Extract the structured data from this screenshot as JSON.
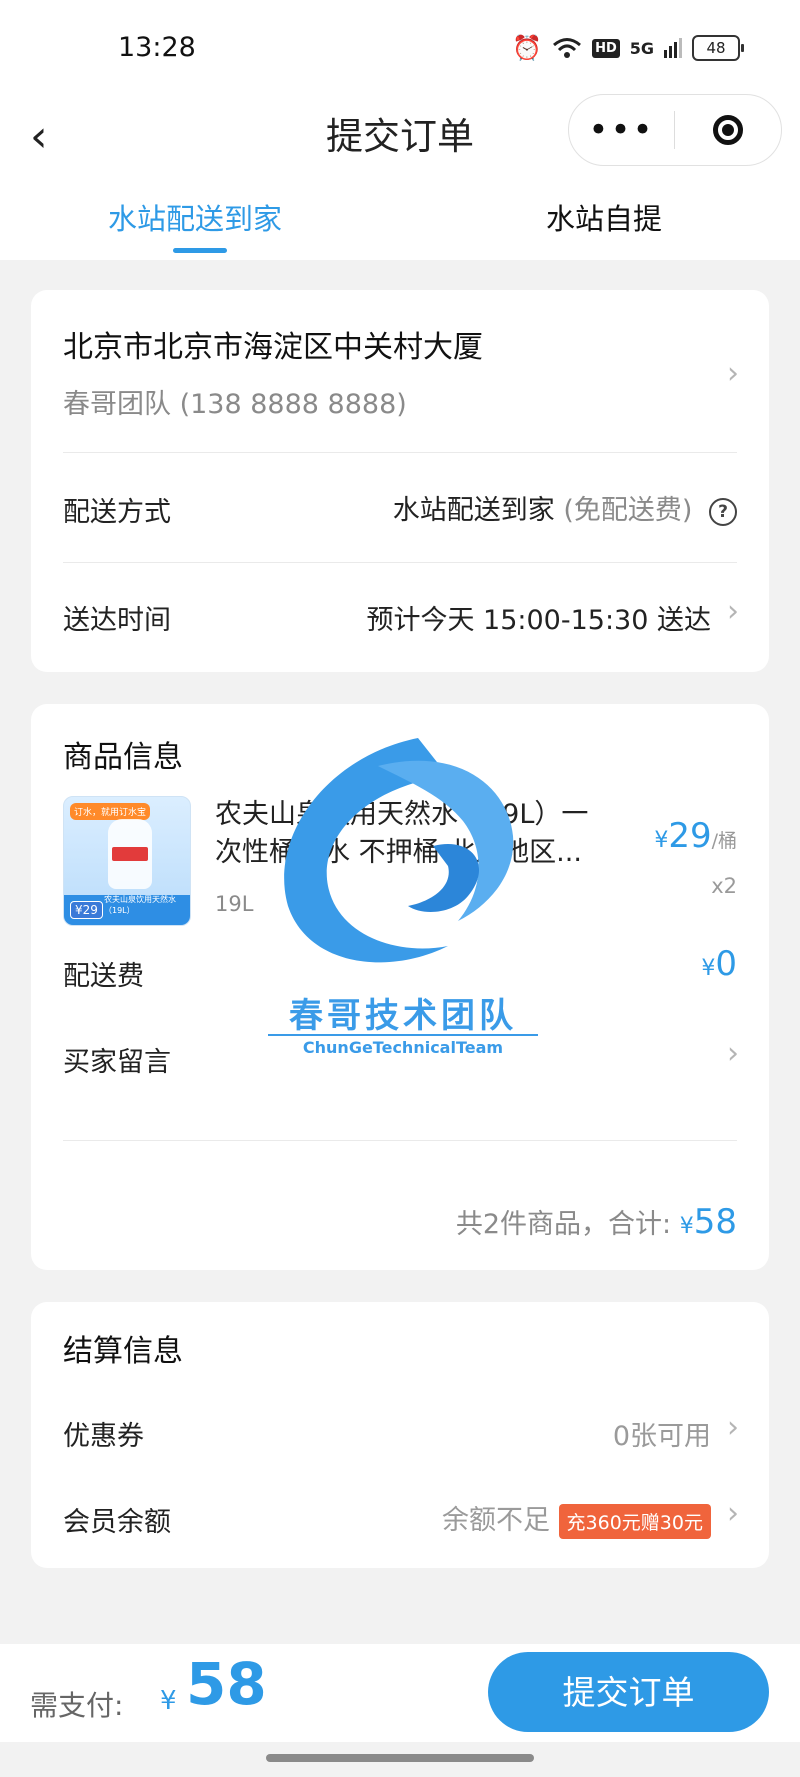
{
  "status_bar": {
    "time": "13:28",
    "battery": "48",
    "hd": "HD",
    "signal": "5G"
  },
  "header": {
    "title": "提交订单",
    "back_icon": "‹",
    "more_icon": "•••"
  },
  "tabs": [
    {
      "label": "水站配送到家",
      "active": true
    },
    {
      "label": "水站自提",
      "active": false
    }
  ],
  "address": {
    "line": "北京市北京市海淀区中关村大厦",
    "contact": "春哥团队 (138 8888 8888)"
  },
  "delivery": {
    "method_label": "配送方式",
    "method_value": "水站配送到家",
    "method_note": "(免配送费)",
    "time_label": "送达时间",
    "time_value": "预计今天 15:00-15:30 送达"
  },
  "goods": {
    "title": "商品信息",
    "product": {
      "name": "农夫山泉饮用天然水（19L）一次性桶装水 不押桶 北京地区...",
      "spec": "19L",
      "currency": "¥",
      "price": "29",
      "unit": "/桶",
      "qty": "x2",
      "img_tag": "订水，就用订水宝",
      "img_price": "¥29",
      "img_name": "农夫山泉饮用天然水（19L）"
    },
    "fee_label": "配送费",
    "fee_currency": "¥",
    "fee_value": "0",
    "message_label": "买家留言",
    "summary_text": "共2件商品，合计:",
    "summary_currency": "¥",
    "summary_amount": "58"
  },
  "settlement": {
    "title": "结算信息",
    "coupon_label": "优惠券",
    "coupon_value": "0张可用",
    "balance_label": "会员余额",
    "balance_value": "余额不足",
    "promo_badge": "充360元赠30元"
  },
  "watermark": {
    "cn": "春哥技术团队",
    "en": "ChunGeTechnicalTeam"
  },
  "footer": {
    "pay_label": "需支付:",
    "pay_currency": "¥",
    "pay_amount": "58",
    "submit_label": "提交订单"
  },
  "colors": {
    "accent": "#2e9ae6",
    "promo": "#f0643c"
  }
}
